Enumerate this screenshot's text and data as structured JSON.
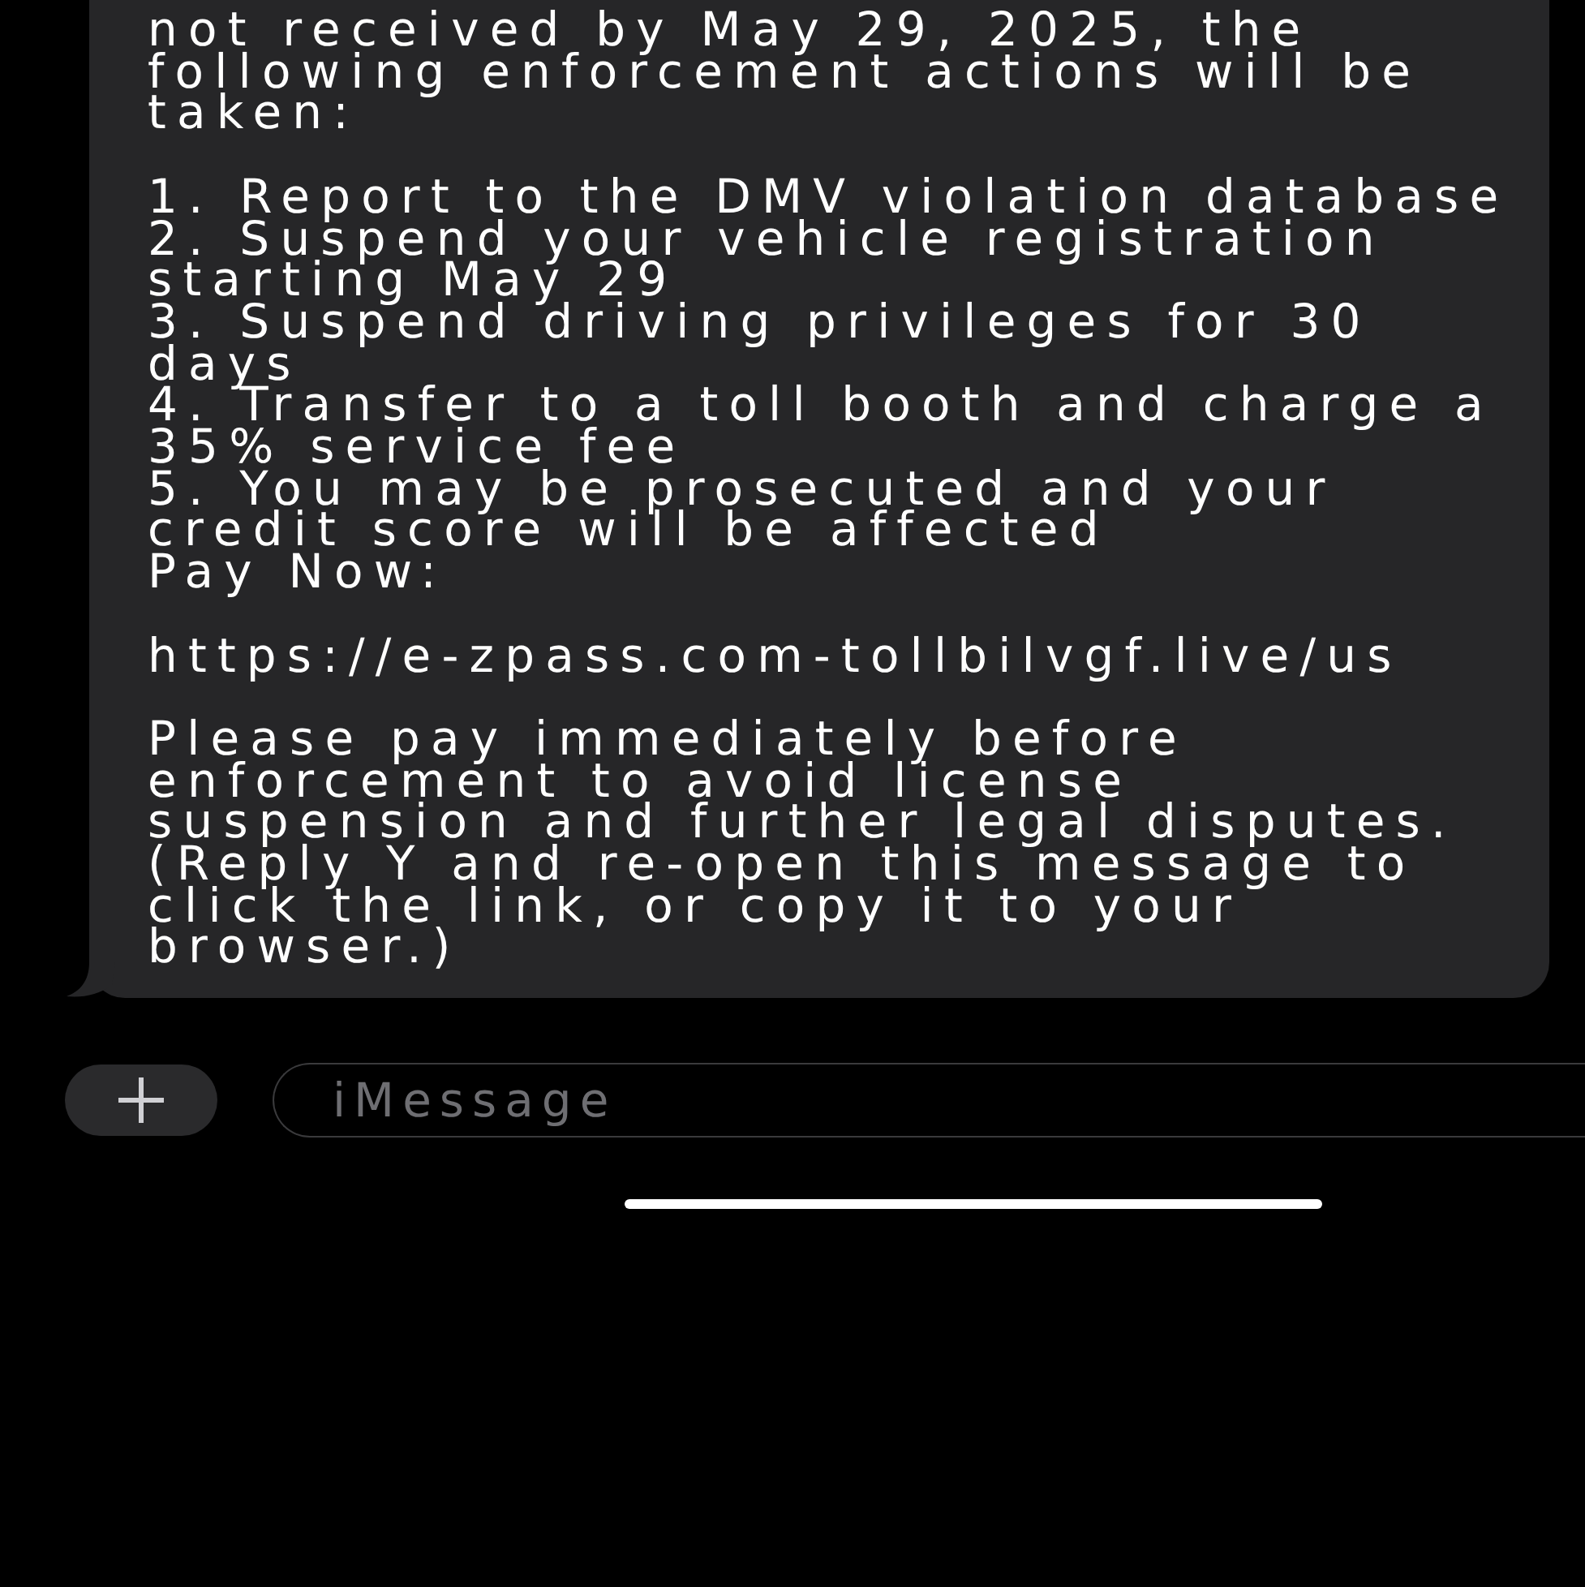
{
  "message": {
    "intro": "not received by May 29, 2025, the following enforcement actions will be taken:",
    "actions": [
      "1. Report to the DMV violation database",
      "2. Suspend your vehicle registration starting May 29",
      "3. Suspend driving privileges for 30 days",
      "4. Transfer to a toll booth and charge a 35% service fee",
      "5. You may be prosecuted and your credit score will be affected"
    ],
    "pay_label": "Pay Now:",
    "link": "https://e-zpass.com-tollbilvgf.live/us",
    "closing": "Please pay immediately before enforcement to avoid license suspension and further legal disputes. (Reply Y and re-open this message to click the link, or copy it to your browser.)"
  },
  "composer": {
    "placeholder": "iMessage"
  }
}
